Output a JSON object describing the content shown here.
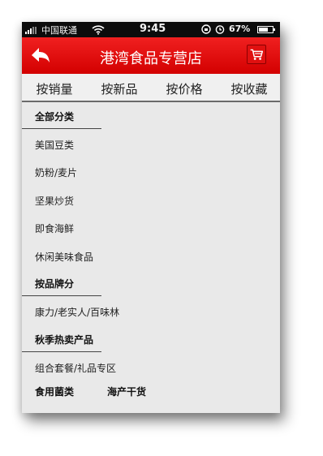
{
  "status_bar": {
    "carrier": "中国联通",
    "time": "9:45",
    "battery": "67%",
    "battery_level": 0.67
  },
  "header": {
    "title": "港湾食品专营店"
  },
  "sort_tabs": [
    "按销量",
    "按新品",
    "按价格",
    "按收藏"
  ],
  "categories": {
    "all_title": "全部分类",
    "items": [
      "美国豆类",
      "奶粉/麦片",
      "坚果炒货",
      "即食海鲜",
      "休闲美味食品"
    ],
    "brand_title": "按品牌分",
    "brand_items": [
      "康力/老实人/百味林"
    ],
    "season_title": "秋季热卖产品",
    "season_items": [
      "组合套餐/礼品专区"
    ],
    "bottom_titles": [
      "食用菌类",
      "海产干货"
    ]
  },
  "colors": {
    "header_red": "#e30f0f",
    "status_bar": "#0c0c0c",
    "page_bg": "#e9e9e9"
  },
  "icons": [
    "signal-icon",
    "wifi-icon",
    "rotation-lock-icon",
    "alarm-icon",
    "battery-icon",
    "back-arrow-icon",
    "cart-icon"
  ]
}
